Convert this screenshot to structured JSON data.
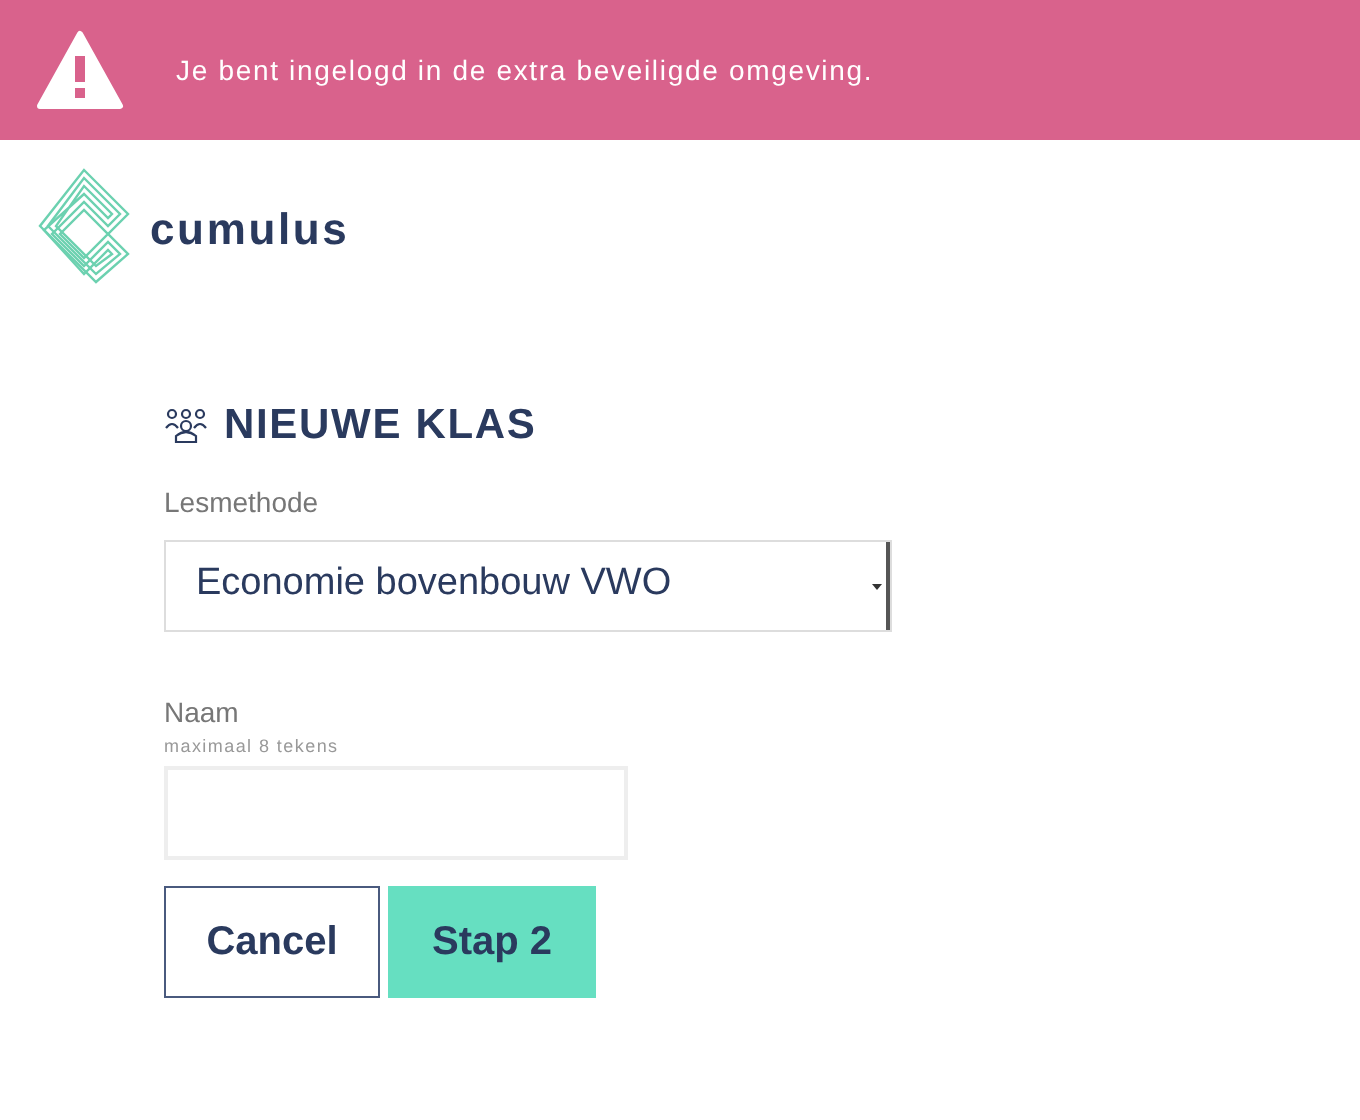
{
  "banner": {
    "message": "Je bent ingelogd in de extra beveiligde omgeving."
  },
  "logo": {
    "text": "cumulus"
  },
  "heading": "NIEUWE KLAS",
  "method": {
    "label": "Lesmethode",
    "value": "Economie bovenbouw VWO"
  },
  "name": {
    "label": "Naam",
    "hint": "maximaal 8 tekens"
  },
  "buttons": [
    {
      "label": "Cancel",
      "kind": "secondary"
    },
    {
      "label": "Stap 2",
      "kind": "primary"
    }
  ]
}
